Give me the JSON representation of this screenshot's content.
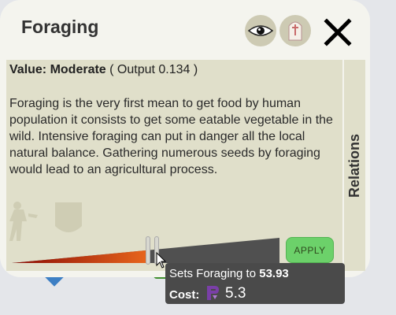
{
  "panel": {
    "title": "Foraging",
    "value_label": "Value: Moderate",
    "output_text": "( Output 0.134 )",
    "description": "Foraging is the very first mean to get food by human population it consists to get some eatable vegetable in the wild. Intensive foraging can put in danger all the local natural balance. Gathering numerous seeds by foraging would lead to an agricultural process.",
    "relations_tab": "Relations",
    "apply_label": "APPLY"
  },
  "slider": {
    "current_fraction": 0.51,
    "target_fraction": 0.54,
    "fill_from": "#8a0b05",
    "fill_to": "#e8661c",
    "track_color": "#505050"
  },
  "tooltip": {
    "sets_prefix": "Sets Foraging to",
    "sets_value": "53.93",
    "cost_label": "Cost:",
    "cost_value": "5.3",
    "cost_icon": "research-icon"
  },
  "colors": {
    "panel_bg": "#f4f4ee",
    "content_bg": "#e0dfca",
    "apply_green": "#6cd16a",
    "tooltip_bg": "#4a4a4a",
    "research_purple": "#7a3fa8"
  }
}
